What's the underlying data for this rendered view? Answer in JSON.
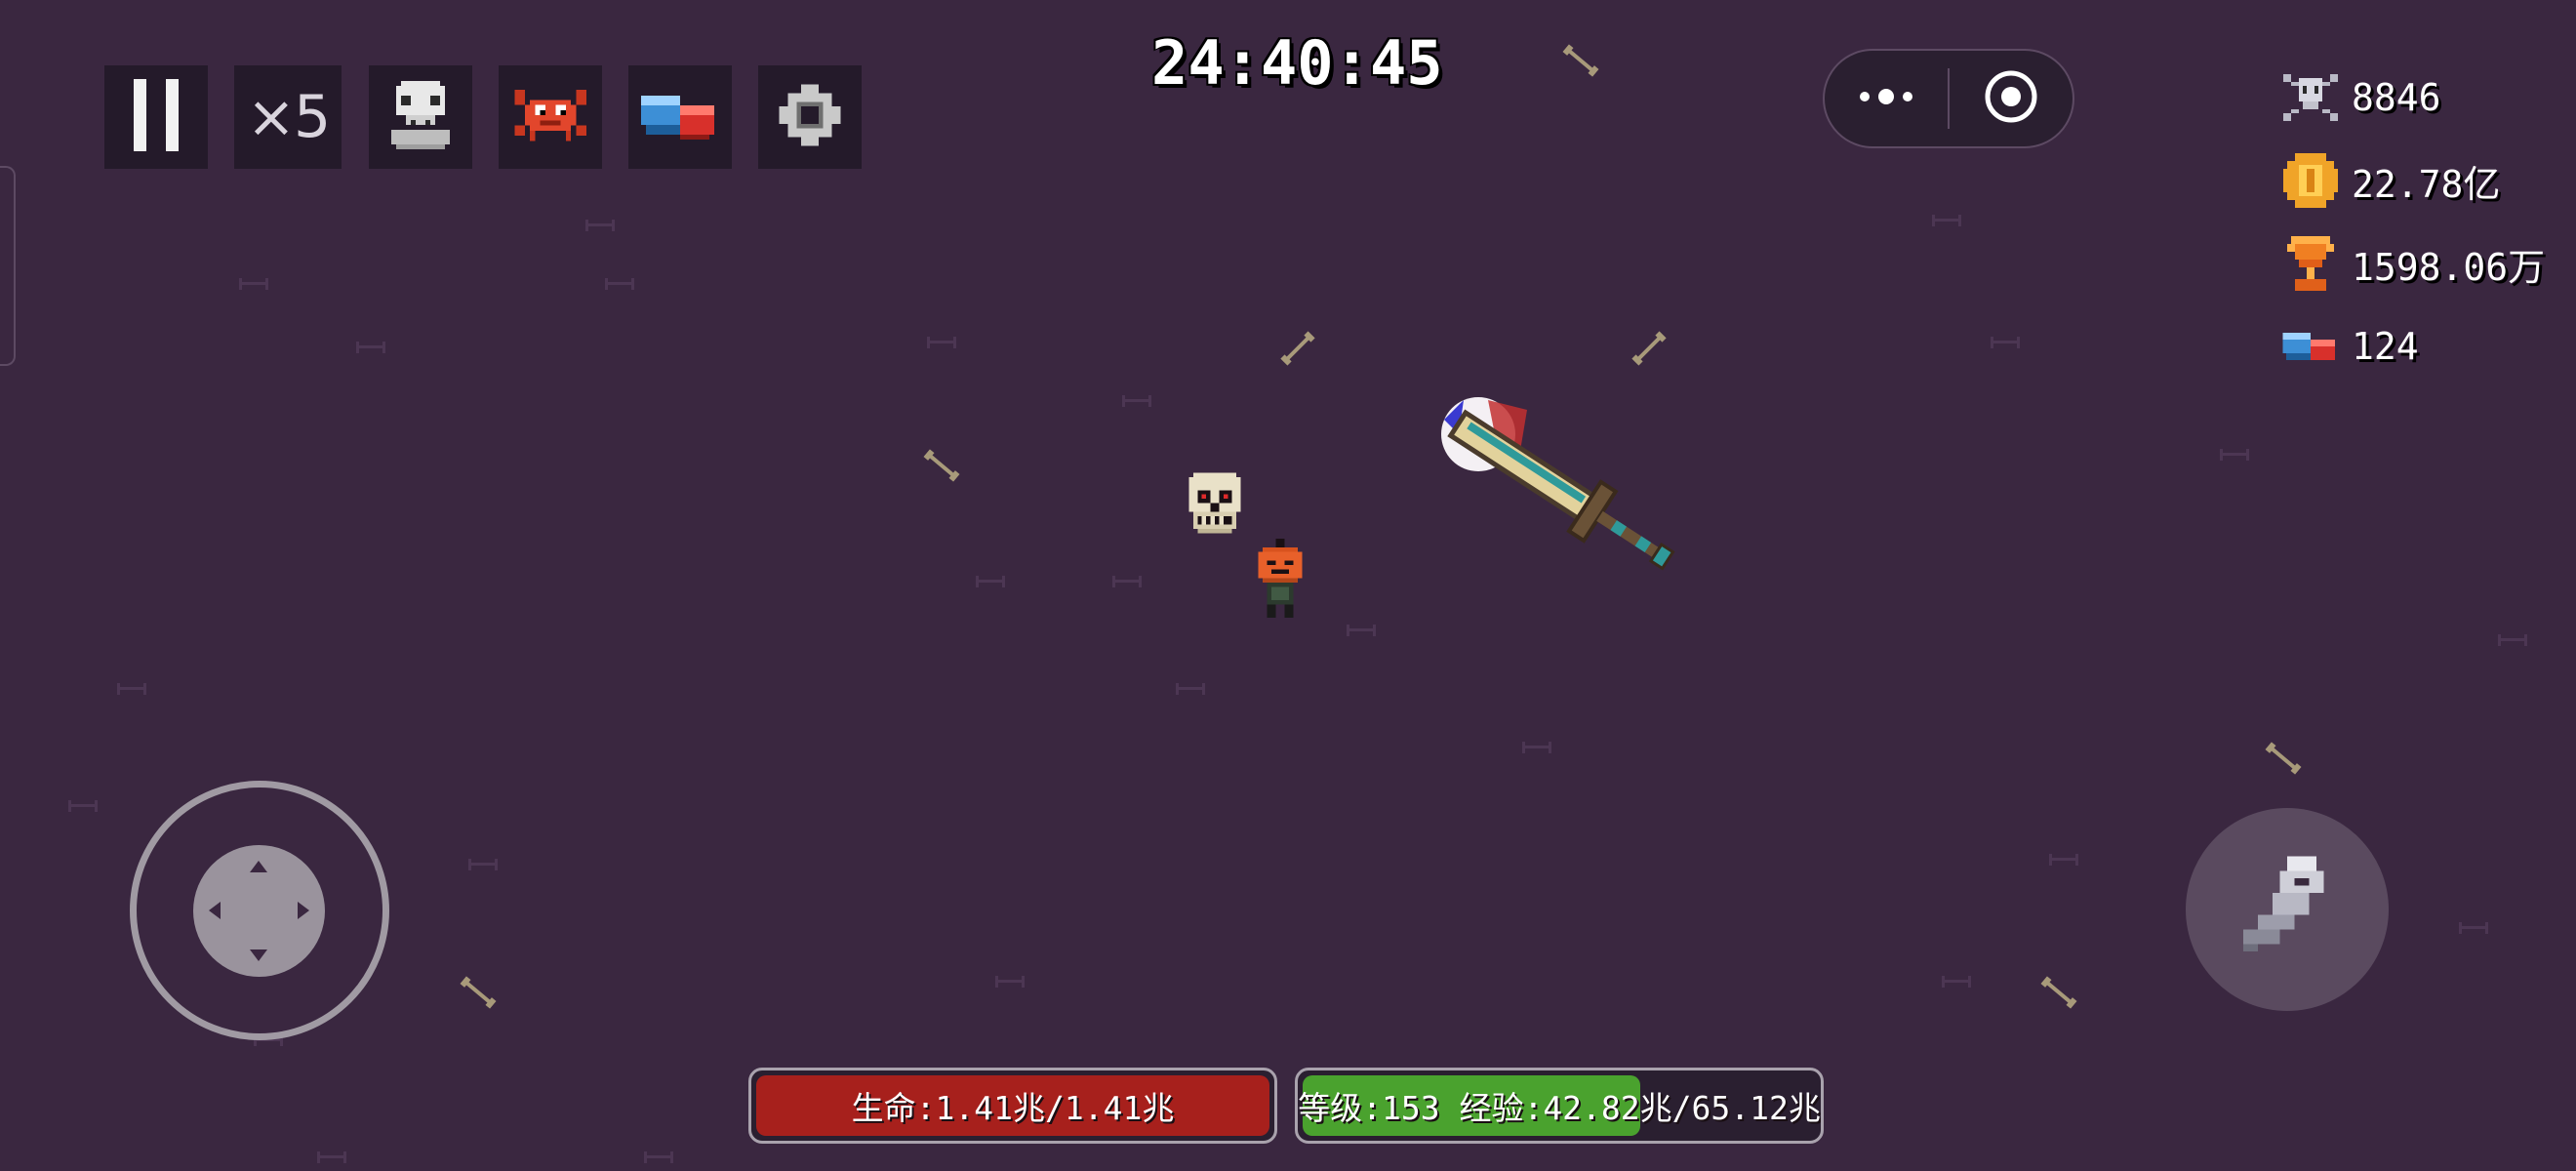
{
  "toolbar": {
    "speed_label": "×5",
    "buttons": [
      "pause-icon",
      "speed-multiplier",
      "skull-icon",
      "red-crab-icon",
      "magnet-icon",
      "gear-icon"
    ]
  },
  "timer": "24:40:45",
  "menu_capsule": {
    "icons": [
      "more-dots-icon",
      "record-target-icon"
    ]
  },
  "resources": {
    "kills": "8846",
    "coins": "22.78亿",
    "trophies": "1598.06万",
    "magnets": "124"
  },
  "status": {
    "health_label": "生命:1.41兆/1.41兆",
    "health_fraction": 1.0,
    "level_label": "等级:153 经验:42.82兆/65.12兆",
    "exp_fraction": 0.6576
  },
  "colors": {
    "background": "#3a2740",
    "health_fill": "#a7201c",
    "exp_fill": "#4aa22e"
  }
}
